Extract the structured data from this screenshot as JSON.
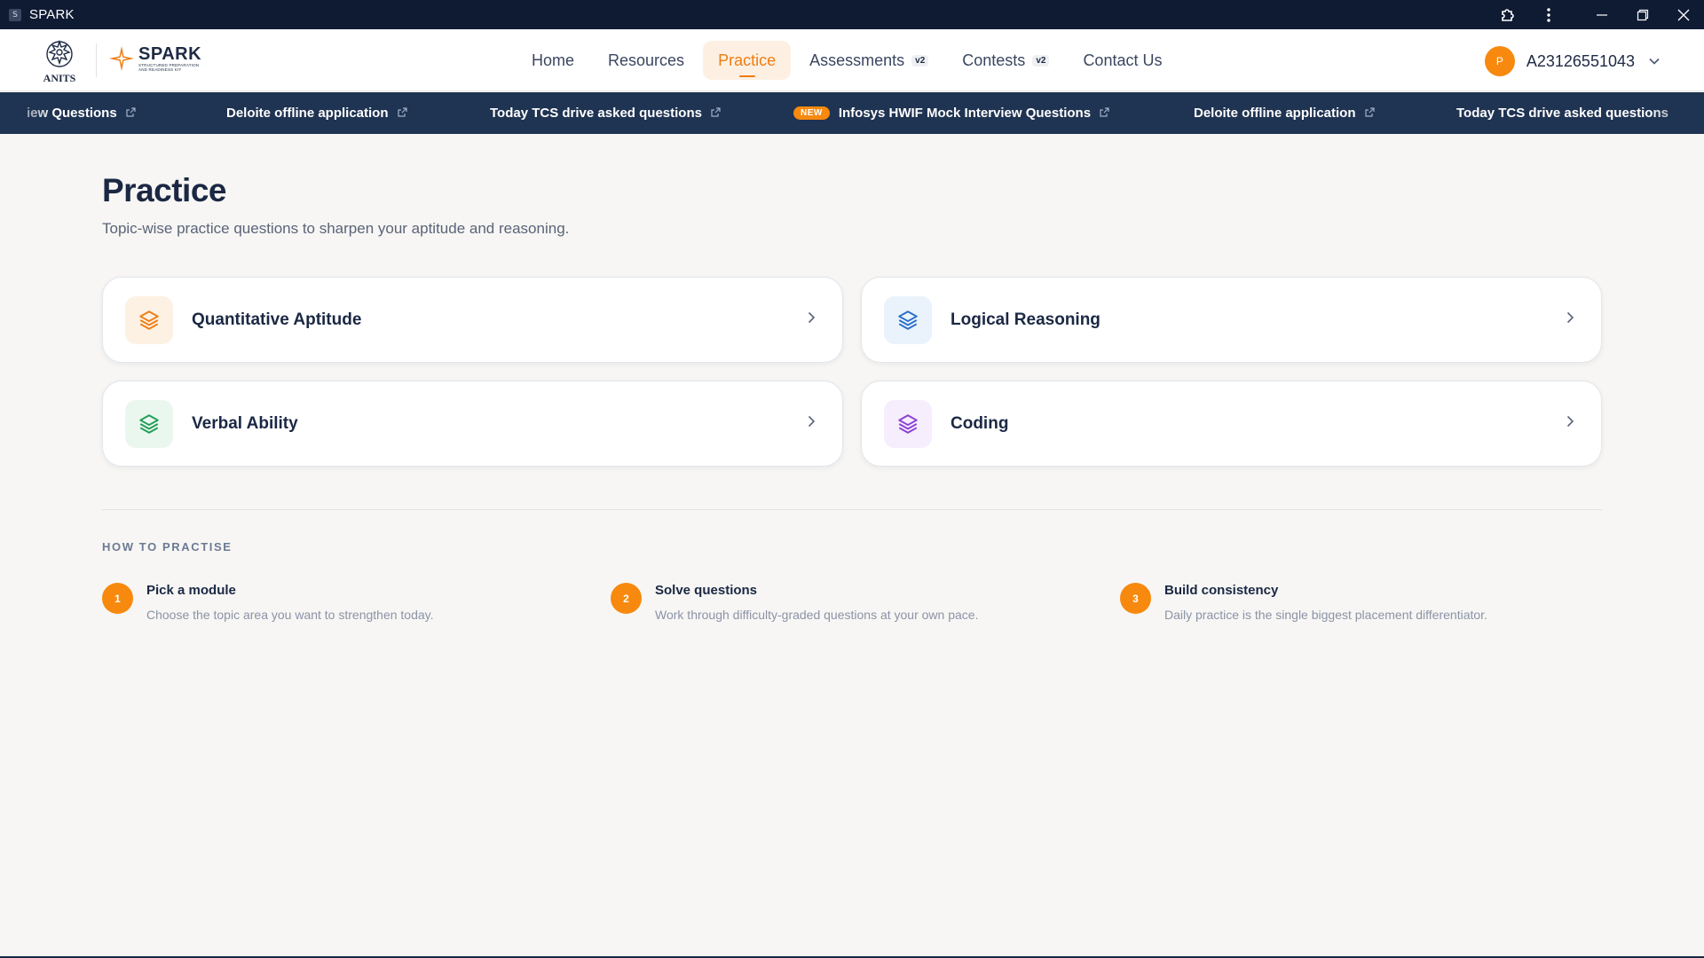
{
  "window": {
    "title": "SPARK",
    "app_icon_letter": "S"
  },
  "brand": {
    "college": "ANITS",
    "name": "SPARK",
    "tagline_line1": "STRUCTURED PREPARATION",
    "tagline_line2": "AND READINESS KIT"
  },
  "nav": {
    "items": [
      {
        "label": "Home"
      },
      {
        "label": "Resources"
      },
      {
        "label": "Practice"
      },
      {
        "label": "Assessments",
        "badge": "v2"
      },
      {
        "label": "Contests",
        "badge": "v2"
      },
      {
        "label": "Contact Us"
      }
    ],
    "active": "Practice"
  },
  "user": {
    "avatar_initial": "P",
    "id": "A23126551043"
  },
  "ticker": {
    "items": [
      {
        "label": "iew Questions"
      },
      {
        "label": "Deloite offline application"
      },
      {
        "label": "Today TCS drive asked questions"
      },
      {
        "label": "Infosys HWIF Mock Interview Questions",
        "badge": "NEW"
      },
      {
        "label": "Deloite offline application"
      },
      {
        "label": "Today TCS drive asked questions"
      }
    ]
  },
  "page": {
    "title": "Practice",
    "subtitle": "Topic-wise practice questions to sharpen your aptitude and reasoning."
  },
  "modules": [
    {
      "label": "Quantitative Aptitude",
      "icon": "layers-icon",
      "color": "#f07c12",
      "bg": "#fdf1e4"
    },
    {
      "label": "Logical Reasoning",
      "icon": "layers-icon",
      "color": "#2a6fc9",
      "bg": "#eaf3fb"
    },
    {
      "label": "Verbal Ability",
      "icon": "layers-icon",
      "color": "#1f9d55",
      "bg": "#eaf7ef"
    },
    {
      "label": "Coding",
      "icon": "layers-icon",
      "color": "#8b3fd6",
      "bg": "#f6eefc"
    }
  ],
  "how": {
    "title": "HOW TO PRACTISE",
    "steps": [
      {
        "num": "1",
        "title": "Pick a module",
        "desc": "Choose the topic area you want to strengthen today."
      },
      {
        "num": "2",
        "title": "Solve questions",
        "desc": "Work through difficulty-graded questions at your own pace."
      },
      {
        "num": "3",
        "title": "Build consistency",
        "desc": "Daily practice is the single biggest placement differentiator."
      }
    ]
  },
  "colors": {
    "accent": "#f7890e",
    "navy": "#1f3352",
    "titlebar": "#0f1b33"
  }
}
